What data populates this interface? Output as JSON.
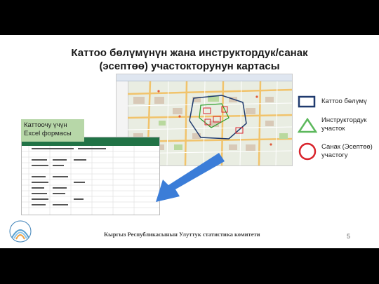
{
  "slide": {
    "title_line1": "Каттоо бөлүмүнүн жана инструктордук/санак",
    "title_line2": "(эсептөө) участокторунун картасы",
    "excel_label": "Каттоочу үчүн Excel формасы",
    "legend": [
      {
        "label": "Каттоо бөлүмү",
        "shape": "square-icon",
        "color": "#1f3a6e"
      },
      {
        "label": "Инструктордук участок",
        "shape": "triangle-icon",
        "color": "#5cb85c"
      },
      {
        "label": "Санак (Эсептөө) участогу",
        "shape": "circle-icon",
        "color": "#d9242c"
      }
    ],
    "footer": "Кыргыз Республикасынын Улуттук статистика комитети",
    "page_number": "5",
    "arrow_color": "#3b7dd8"
  }
}
